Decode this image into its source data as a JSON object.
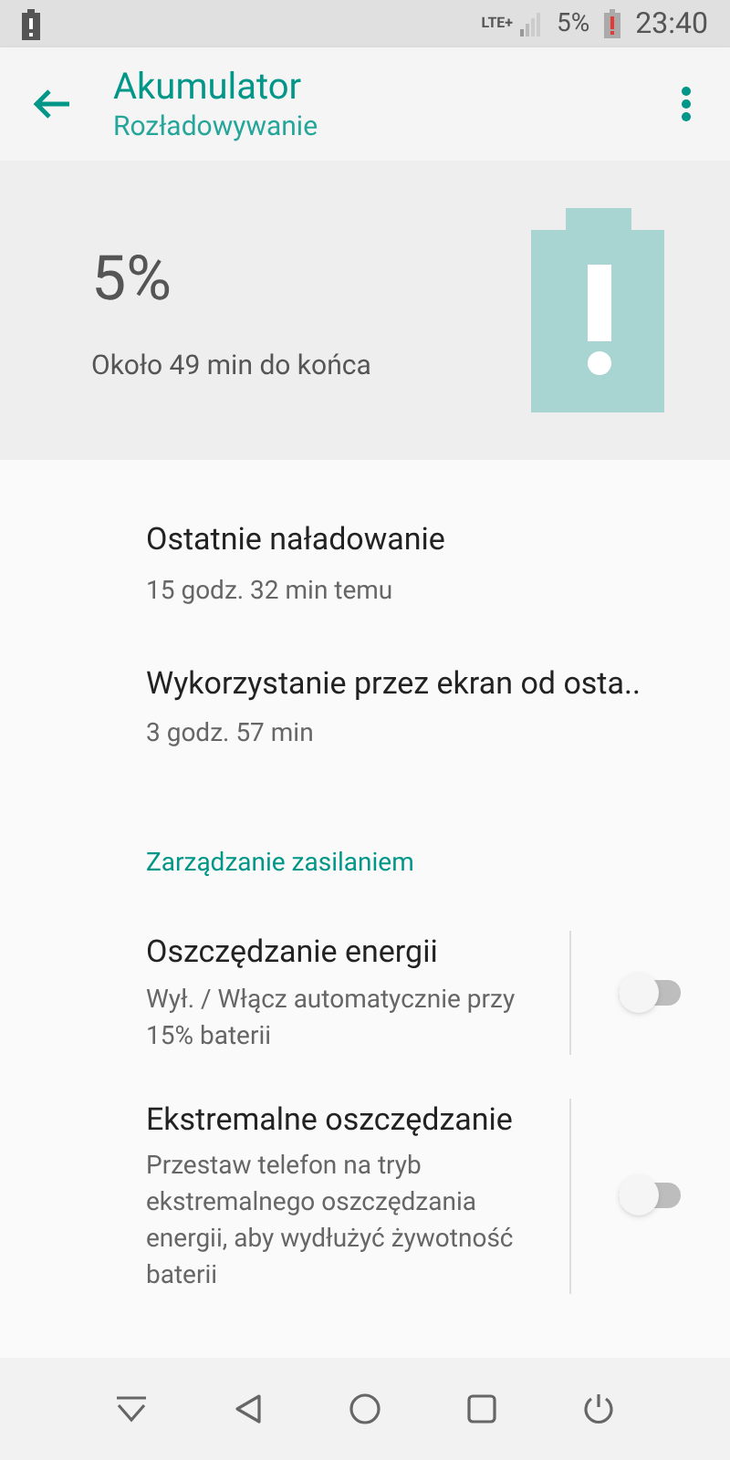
{
  "status_bar": {
    "network": "LTE+",
    "battery": "5%",
    "time": "23:40"
  },
  "app_bar": {
    "title": "Akumulator",
    "subtitle": "Rozładowywanie"
  },
  "header": {
    "percent": "5%",
    "remaining": "Około 49 min do końca"
  },
  "items": [
    {
      "kind": "info",
      "title": "Ostatnie naładowanie",
      "subtitle": "15 godz. 32 min temu"
    },
    {
      "kind": "info",
      "title": "Wykorzystanie przez ekran od osta..",
      "subtitle": "3 godz. 57 min"
    },
    {
      "kind": "section",
      "title": "Zarządzanie zasilaniem"
    },
    {
      "kind": "toggle",
      "title": "Oszczędzanie energii",
      "subtitle": "Wył. / Włącz automatycznie przy 15% baterii",
      "on": false
    },
    {
      "kind": "toggle",
      "title": "Ekstremalne oszczędzanie",
      "subtitle": "Przestaw telefon na tryb ekstremalnego oszczędzania energii, aby wydłużyć żywotność baterii",
      "on": false
    }
  ]
}
